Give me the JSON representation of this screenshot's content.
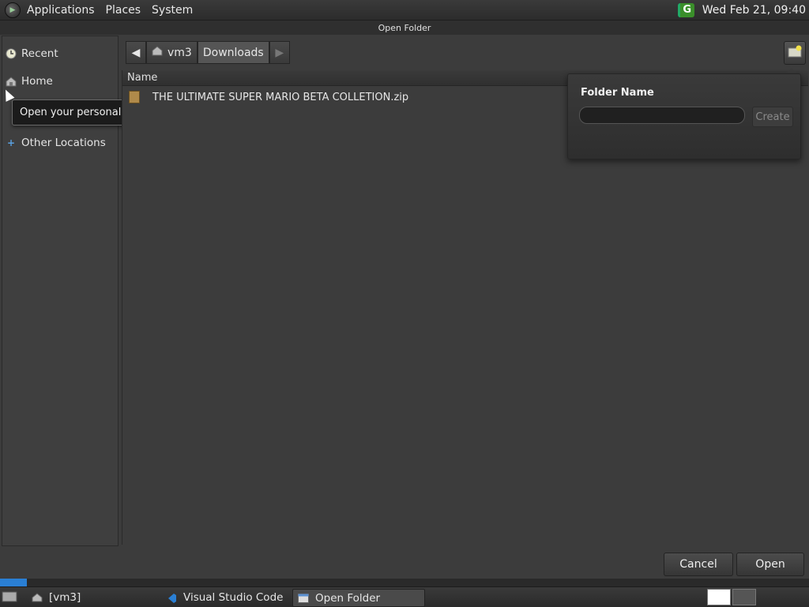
{
  "top_panel": {
    "menus": [
      "Applications",
      "Places",
      "System"
    ],
    "clock": "Wed Feb 21, 09:40",
    "updates_glyph": "G"
  },
  "dialog": {
    "title": "Open Folder",
    "sidebar": {
      "items": [
        {
          "label": "Recent",
          "icon": "clock-icon"
        },
        {
          "label": "Home",
          "icon": "home-icon"
        },
        {
          "label": "Other Locations",
          "icon": "plus-icon"
        }
      ],
      "tooltip": "Open your personal folder"
    },
    "pathbar": {
      "segments": [
        "vm3",
        "Downloads"
      ]
    },
    "file_list": {
      "column_name": "Name",
      "files": [
        "THE ULTIMATE SUPER MARIO BETA COLLETION.zip"
      ]
    },
    "new_folder_popover": {
      "title": "Folder Name",
      "input_value": "",
      "create_label": "Create"
    },
    "buttons": {
      "cancel": "Cancel",
      "open": "Open"
    }
  },
  "taskbar": {
    "tasks": [
      {
        "label": "[vm3]",
        "active": false
      },
      {
        "label": "Visual Studio Code",
        "active": false
      },
      {
        "label": "Open Folder",
        "active": true
      }
    ]
  },
  "colors": {
    "accent_green": "#3a8f2a",
    "vscode_blue": "#2a7fd4",
    "background": "#3c3c3c"
  }
}
